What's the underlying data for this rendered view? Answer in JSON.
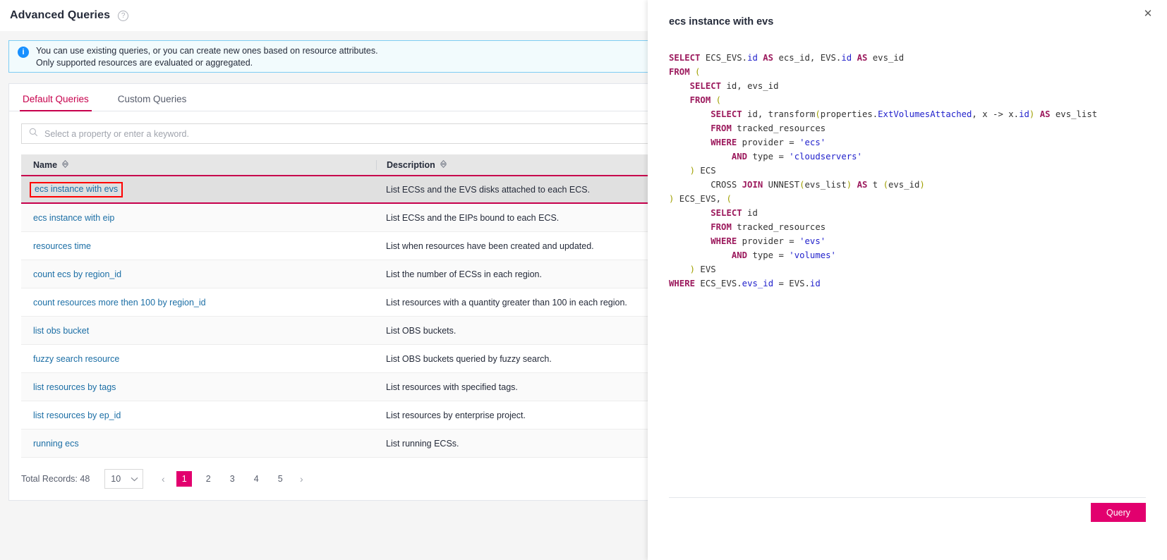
{
  "header": {
    "title": "Advanced Queries",
    "help_icon": "question-mark-circle-icon"
  },
  "alert": {
    "icon": "info-icon",
    "line1": "You can use existing queries, or you can create new ones based on resource attributes.",
    "line2": "Only supported resources are evaluated or aggregated."
  },
  "tabs": [
    {
      "label": "Default Queries",
      "active": true
    },
    {
      "label": "Custom Queries",
      "active": false
    }
  ],
  "search": {
    "icon": "search-icon",
    "placeholder": "Select a property or enter a keyword.",
    "value": ""
  },
  "table": {
    "columns": [
      {
        "label": "Name",
        "sort_icon": "sort-toggle-icon"
      },
      {
        "label": "Description",
        "sort_icon": "sort-toggle-icon"
      }
    ],
    "rows": [
      {
        "name": "ecs instance with evs",
        "description": "List ECSs and the EVS disks attached to each ECS.",
        "selected": true,
        "highlight_box": true
      },
      {
        "name": "ecs instance with eip",
        "description": "List ECSs and the EIPs bound to each ECS.",
        "selected": false,
        "highlight_box": false
      },
      {
        "name": "resources time",
        "description": "List when resources have been created and updated.",
        "selected": false,
        "highlight_box": false
      },
      {
        "name": "count ecs by region_id",
        "description": "List the number of ECSs in each region.",
        "selected": false,
        "highlight_box": false
      },
      {
        "name": "count resources more then 100 by region_id",
        "description": "List resources with a quantity greater than 100 in each region.",
        "selected": false,
        "highlight_box": false
      },
      {
        "name": "list obs bucket",
        "description": "List OBS buckets.",
        "selected": false,
        "highlight_box": false
      },
      {
        "name": "fuzzy search resource",
        "description": "List OBS buckets queried by fuzzy search.",
        "selected": false,
        "highlight_box": false
      },
      {
        "name": "list resources by tags",
        "description": "List resources with specified tags.",
        "selected": false,
        "highlight_box": false
      },
      {
        "name": "list resources by ep_id",
        "description": "List resources by enterprise project.",
        "selected": false,
        "highlight_box": false
      },
      {
        "name": "running ecs",
        "description": "List running ECSs.",
        "selected": false,
        "highlight_box": false
      }
    ]
  },
  "pagination": {
    "total_label": "Total Records: 48",
    "page_size": "10",
    "page_size_caret": "chevron-down-icon",
    "prev": "‹",
    "next": "›",
    "pages": [
      "1",
      "2",
      "3",
      "4",
      "5"
    ],
    "current_page": "1"
  },
  "drawer": {
    "close_icon": "close-icon",
    "title": "ecs instance with evs",
    "query_button": "Query",
    "sql_lines": [
      [
        {
          "t": "SELECT",
          "c": "k"
        },
        {
          "t": " ECS_EVS.",
          "c": "n"
        },
        {
          "t": "id",
          "c": "f"
        },
        {
          "t": " ",
          "c": "n"
        },
        {
          "t": "AS",
          "c": "k"
        },
        {
          "t": " ecs_id, EVS.",
          "c": "n"
        },
        {
          "t": "id",
          "c": "f"
        },
        {
          "t": " ",
          "c": "n"
        },
        {
          "t": "AS",
          "c": "k"
        },
        {
          "t": " evs_id",
          "c": "n"
        }
      ],
      [
        {
          "t": "FROM",
          "c": "k"
        },
        {
          "t": " ",
          "c": "n"
        },
        {
          "t": "(",
          "c": "p"
        }
      ],
      [
        {
          "t": "    ",
          "c": "n"
        },
        {
          "t": "SELECT",
          "c": "k"
        },
        {
          "t": " id, evs_id",
          "c": "n"
        }
      ],
      [
        {
          "t": "    ",
          "c": "n"
        },
        {
          "t": "FROM",
          "c": "k"
        },
        {
          "t": " ",
          "c": "n"
        },
        {
          "t": "(",
          "c": "p"
        }
      ],
      [
        {
          "t": "        ",
          "c": "n"
        },
        {
          "t": "SELECT",
          "c": "k"
        },
        {
          "t": " id, transform",
          "c": "n"
        },
        {
          "t": "(",
          "c": "p"
        },
        {
          "t": "properties.",
          "c": "n"
        },
        {
          "t": "ExtVolumesAttached",
          "c": "f"
        },
        {
          "t": ", x -> x.",
          "c": "n"
        },
        {
          "t": "id",
          "c": "f"
        },
        {
          "t": ")",
          "c": "p"
        },
        {
          "t": " ",
          "c": "n"
        },
        {
          "t": "AS",
          "c": "k"
        },
        {
          "t": " evs_list",
          "c": "n"
        }
      ],
      [
        {
          "t": "        ",
          "c": "n"
        },
        {
          "t": "FROM",
          "c": "k"
        },
        {
          "t": " tracked_resources",
          "c": "n"
        }
      ],
      [
        {
          "t": "        ",
          "c": "n"
        },
        {
          "t": "WHERE",
          "c": "k"
        },
        {
          "t": " provider = ",
          "c": "n"
        },
        {
          "t": "'ecs'",
          "c": "f"
        }
      ],
      [
        {
          "t": "            ",
          "c": "n"
        },
        {
          "t": "AND",
          "c": "k"
        },
        {
          "t": " type = ",
          "c": "n"
        },
        {
          "t": "'cloudservers'",
          "c": "f"
        }
      ],
      [
        {
          "t": "    ",
          "c": "n"
        },
        {
          "t": ")",
          "c": "p"
        },
        {
          "t": " ECS",
          "c": "n"
        }
      ],
      [
        {
          "t": "        ",
          "c": "n"
        },
        {
          "t": "CROSS ",
          "c": "n"
        },
        {
          "t": "JOIN",
          "c": "k"
        },
        {
          "t": " UNNEST",
          "c": "n"
        },
        {
          "t": "(",
          "c": "p"
        },
        {
          "t": "evs_list",
          "c": "n"
        },
        {
          "t": ")",
          "c": "p"
        },
        {
          "t": " ",
          "c": "n"
        },
        {
          "t": "AS",
          "c": "k"
        },
        {
          "t": " t ",
          "c": "n"
        },
        {
          "t": "(",
          "c": "p"
        },
        {
          "t": "evs_id",
          "c": "n"
        },
        {
          "t": ")",
          "c": "p"
        }
      ],
      [
        {
          "t": ")",
          "c": "p"
        },
        {
          "t": " ECS_EVS, ",
          "c": "n"
        },
        {
          "t": "(",
          "c": "p"
        }
      ],
      [
        {
          "t": "        ",
          "c": "n"
        },
        {
          "t": "SELECT",
          "c": "k"
        },
        {
          "t": " id",
          "c": "n"
        }
      ],
      [
        {
          "t": "        ",
          "c": "n"
        },
        {
          "t": "FROM",
          "c": "k"
        },
        {
          "t": " tracked_resources",
          "c": "n"
        }
      ],
      [
        {
          "t": "        ",
          "c": "n"
        },
        {
          "t": "WHERE",
          "c": "k"
        },
        {
          "t": " provider = ",
          "c": "n"
        },
        {
          "t": "'evs'",
          "c": "f"
        }
      ],
      [
        {
          "t": "            ",
          "c": "n"
        },
        {
          "t": "AND",
          "c": "k"
        },
        {
          "t": " type = ",
          "c": "n"
        },
        {
          "t": "'volumes'",
          "c": "f"
        }
      ],
      [
        {
          "t": "    ",
          "c": "n"
        },
        {
          "t": ")",
          "c": "p"
        },
        {
          "t": " EVS",
          "c": "n"
        }
      ],
      [
        {
          "t": "WHERE",
          "c": "k"
        },
        {
          "t": " ECS_EVS.",
          "c": "n"
        },
        {
          "t": "evs_id",
          "c": "f"
        },
        {
          "t": " = EVS.",
          "c": "n"
        },
        {
          "t": "id",
          "c": "f"
        }
      ]
    ]
  },
  "colors": {
    "brand_pink": "#e2006e",
    "tab_active": "#c7004c",
    "link_blue": "#1b6ea5",
    "alert_blue": "#1890ff",
    "annotation_red": "#ff0000"
  }
}
